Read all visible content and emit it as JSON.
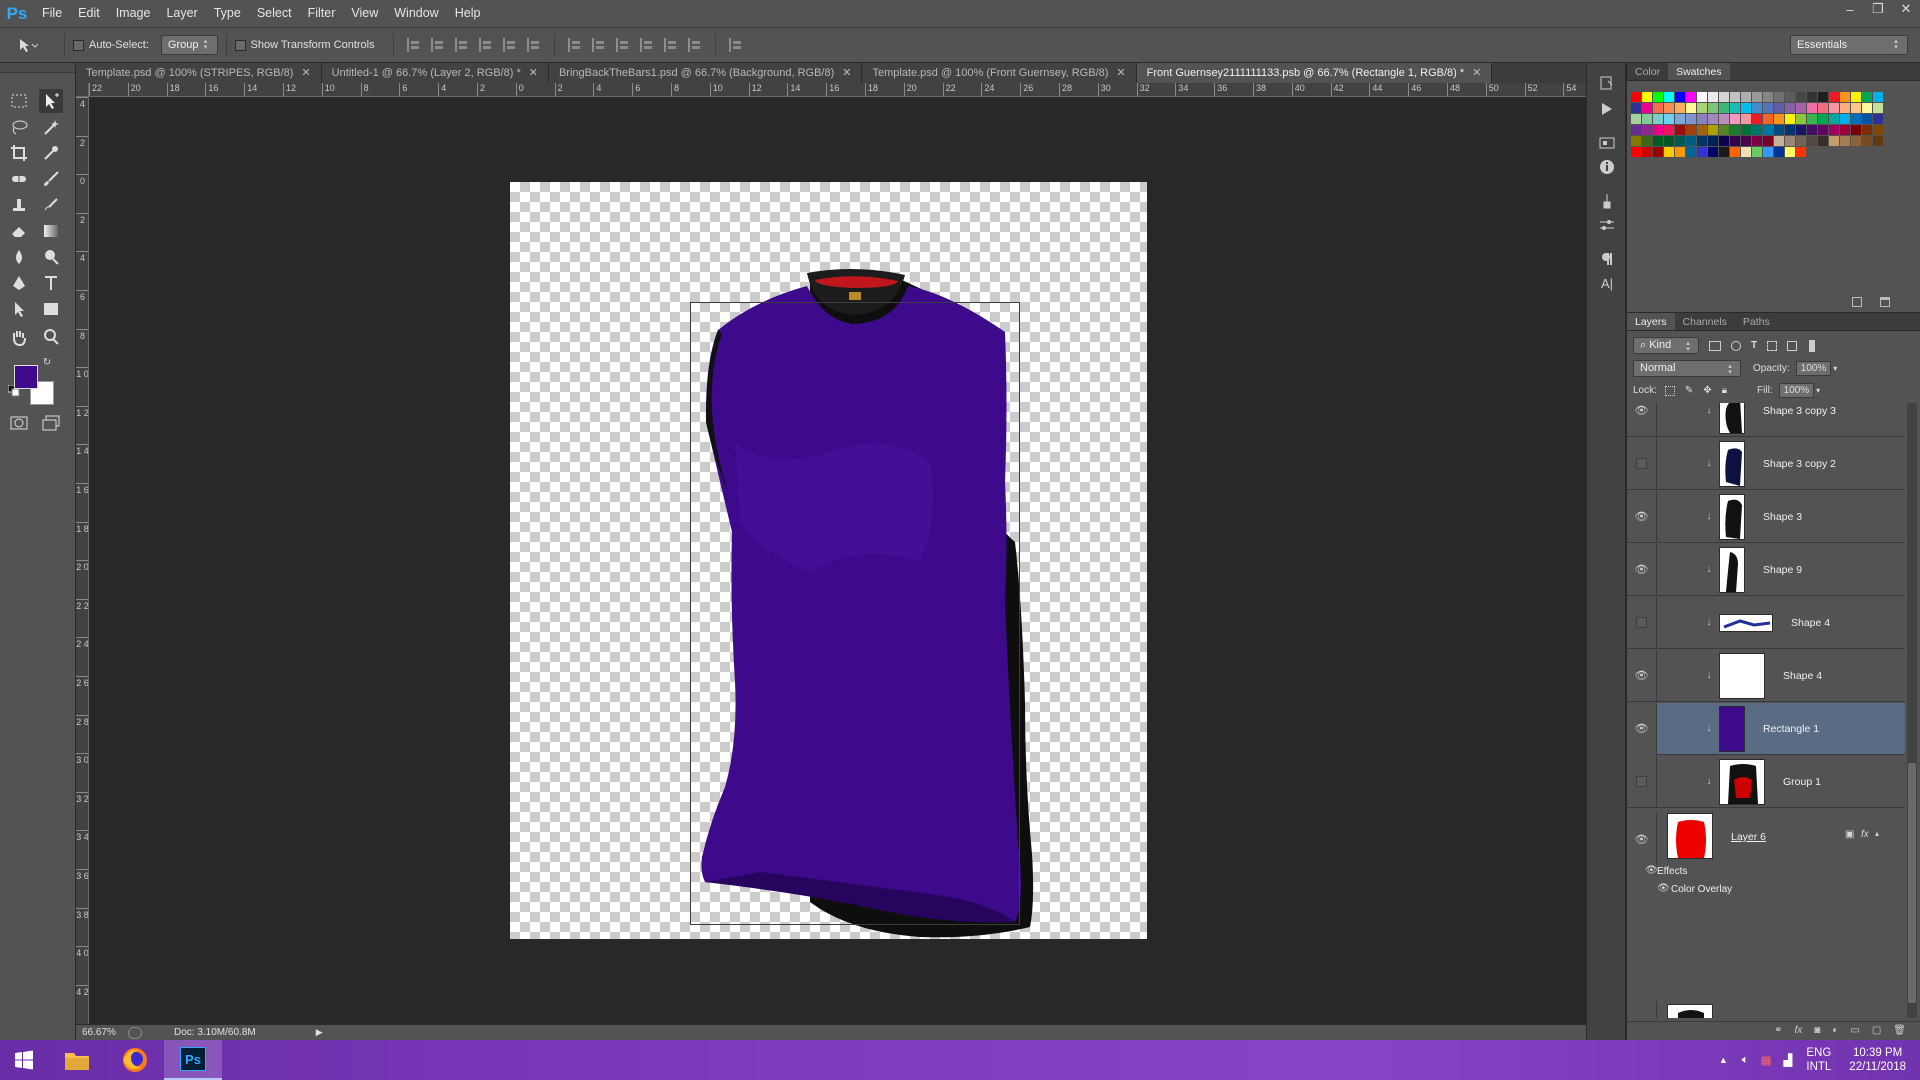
{
  "app": {
    "logo": "Ps"
  },
  "menu": [
    "File",
    "Edit",
    "Image",
    "Layer",
    "Type",
    "Select",
    "Filter",
    "View",
    "Window",
    "Help"
  ],
  "window_controls": {
    "minimize": "–",
    "restore": "❐",
    "close": "✕"
  },
  "options": {
    "auto_select_label": "Auto-Select:",
    "auto_select_value": "Group",
    "transform_label": "Show Transform Controls",
    "workspace": "Essentials"
  },
  "tabs": [
    {
      "label": "Template.psd @ 100% (STRIPES, RGB/8)"
    },
    {
      "label": "Untitled-1 @ 66.7% (Layer 2, RGB/8) *"
    },
    {
      "label": "BringBackTheBars1.psd @ 66.7% (Background, RGB/8)"
    },
    {
      "label": "Template.psd @ 100% (Front Guernsey, RGB/8)"
    },
    {
      "label": "Front Guernsey2111111133.psb @ 66.7% (Rectangle 1, RGB/8) *"
    }
  ],
  "ruler_top_labels": [
    "22",
    "20",
    "18",
    "16",
    "14",
    "12",
    "10",
    "8",
    "6",
    "4",
    "2",
    "0",
    "2",
    "4",
    "6",
    "8",
    "10",
    "12",
    "14",
    "16",
    "18",
    "20",
    "22",
    "24",
    "26",
    "28",
    "30",
    "32",
    "34",
    "36",
    "38",
    "40",
    "42",
    "44",
    "46",
    "48",
    "50",
    "52",
    "54"
  ],
  "ruler_left_labels": [
    "4",
    "2",
    "0",
    "2",
    "4",
    "6",
    "8",
    "1 0",
    "1 2",
    "1 4",
    "1 6",
    "1 8",
    "2 0",
    "2 2",
    "2 4",
    "2 6",
    "2 8",
    "3 0",
    "3 2",
    "3 4",
    "3 6",
    "3 8",
    "4 0",
    "4 2"
  ],
  "status": {
    "zoom": "66.67%",
    "doc": "Doc: 3.10M/60.8M"
  },
  "colors": {
    "foreground": "#3d0a8c",
    "background": "#ffffff",
    "shirt": "#3d0a8c",
    "collar": "#111111"
  },
  "color_panel": {
    "tab_color": "Color",
    "tab_swatches": "Swatches"
  },
  "swatches": [
    "#ff0000",
    "#ffff00",
    "#00ff00",
    "#00ffff",
    "#0000ff",
    "#ff00ff",
    "#ffffff",
    "#ebebeb",
    "#d6d6d6",
    "#c2c2c2",
    "#adadad",
    "#999999",
    "#858585",
    "#707070",
    "#5c5c5c",
    "#474747",
    "#333333",
    "#1f1f1f",
    "#ed1c24",
    "#f7941d",
    "#fff200",
    "#00a651",
    "#00aeef",
    "#2e3192",
    "#ec008c",
    "#f26c4f",
    "#f68e56",
    "#fbaf5d",
    "#fff799",
    "#acd373",
    "#7cc576",
    "#3bb878",
    "#1abbb4",
    "#00bff3",
    "#438ccb",
    "#5574b9",
    "#605ca8",
    "#855fa8",
    "#a763a8",
    "#f06eaa",
    "#f26d7d",
    "#f5989d",
    "#f9ad81",
    "#fdc68a",
    "#fff79a",
    "#c4df9b",
    "#a3d39c",
    "#82ca9d",
    "#7bcdc8",
    "#6ecff6",
    "#7ea7d8",
    "#8493ca",
    "#8882be",
    "#a187be",
    "#bc8dbf",
    "#f49ac1",
    "#f5989d",
    "#ed1c24",
    "#f26522",
    "#f7941d",
    "#fff200",
    "#8dc63f",
    "#39b54a",
    "#00a651",
    "#00a99d",
    "#00aeef",
    "#0072bc",
    "#0054a6",
    "#2e3192",
    "#662d91",
    "#92278f",
    "#ec008c",
    "#ed145b",
    "#9e0b0f",
    "#a0410d",
    "#a3620a",
    "#aba000",
    "#598527",
    "#197b30",
    "#007236",
    "#00746b",
    "#0076a3",
    "#004a80",
    "#003471",
    "#1b1464",
    "#440e62",
    "#630460",
    "#9e005d",
    "#9e0039",
    "#790000",
    "#7b2e00",
    "#7d4900",
    "#827b00",
    "#406618",
    "#005e20",
    "#005826",
    "#005952",
    "#005b7f",
    "#003663",
    "#002157",
    "#0d004c",
    "#32004b",
    "#4b0049",
    "#7b0046",
    "#7a0026",
    "#c7b299",
    "#998675",
    "#736357",
    "#534741",
    "#37302a",
    "#c69c6d",
    "#a67c52",
    "#8c6239",
    "#754c24",
    "#603913",
    "#ff0000",
    "#cc0000",
    "#990000",
    "#ffcc00",
    "#ff9900",
    "#006699",
    "#3333cc",
    "#000066",
    "#1a1a1a",
    "#ff6600",
    "#f5deb3",
    "#66cc66",
    "#3399ff",
    "#003399",
    "#ffff66",
    "#ff3300"
  ],
  "layers_panel": {
    "tabs": [
      "Layers",
      "Channels",
      "Paths"
    ],
    "kind": "Kind",
    "blend_mode": "Normal",
    "opacity_label": "Opacity:",
    "opacity_value": "100%",
    "lock_label": "Lock:",
    "fill_label": "Fill:",
    "fill_value": "100%",
    "layers": [
      {
        "name": "Shape 3 copy 3",
        "visible": true,
        "thumb": "black-sleeve"
      },
      {
        "name": "Shape 3 copy 2",
        "visible": false,
        "thumb": "navy-sleeve"
      },
      {
        "name": "Shape 3",
        "visible": true,
        "thumb": "black-sleeve"
      },
      {
        "name": "Shape 9",
        "visible": true,
        "thumb": "black-side"
      },
      {
        "name": "Shape 4",
        "visible": false,
        "thumb": "wide-stripe"
      },
      {
        "name": "Shape 4",
        "visible": true,
        "thumb": "blank"
      },
      {
        "name": "Rectangle 1",
        "visible": true,
        "thumb": "purple",
        "selected": true
      },
      {
        "name": "Group 1",
        "visible": false,
        "thumb": "red-black"
      },
      {
        "name": "Layer 6",
        "visible": true,
        "thumb": "red-shirt"
      }
    ],
    "effects_label": "Effects",
    "effect_item": "Color Overlay"
  },
  "taskbar": {
    "lang1": "ENG",
    "lang2": "INTL",
    "time": "10:39 PM",
    "date": "22/11/2018"
  }
}
